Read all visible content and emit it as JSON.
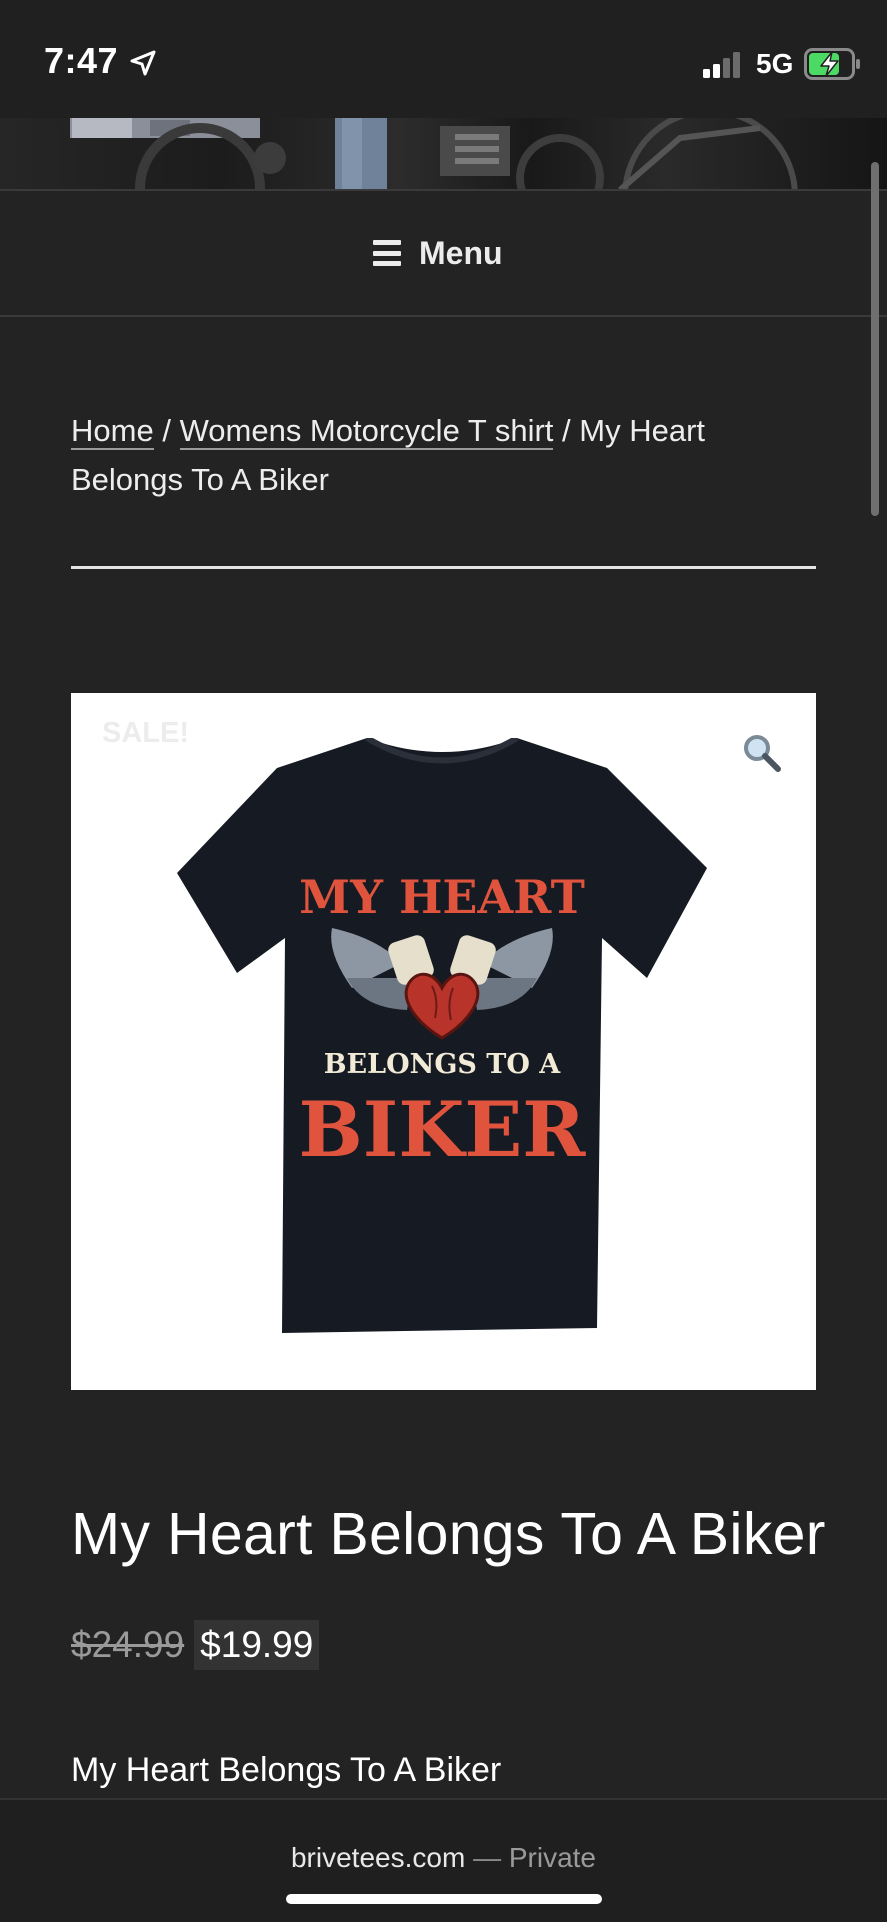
{
  "status_bar": {
    "time": "7:47",
    "network": "5G",
    "icons": [
      "location-arrow-icon",
      "signal-icon",
      "battery-charging-icon"
    ]
  },
  "nav": {
    "menu_label": "Menu",
    "menu_icon": "hamburger-icon"
  },
  "breadcrumb": {
    "items": [
      {
        "label": "Home",
        "link": true
      },
      {
        "label": "Womens Motorcycle T shirt",
        "link": true
      },
      {
        "label": "My Heart Belongs To A Biker",
        "link": false
      }
    ],
    "separator": "/"
  },
  "product": {
    "sale_badge": "SALE!",
    "zoom_icon": "magnifier-icon",
    "shirt_text": {
      "line1": "MY HEART",
      "line2": "BELONGS TO A",
      "line3": "BIKER"
    },
    "title": "My Heart Belongs To A Biker",
    "price_old": "$24.99",
    "price_new": "$19.99",
    "subtitle": "My Heart Belongs To A Biker"
  },
  "browser": {
    "domain": "brivetees.com",
    "separator": "—",
    "mode": "Private"
  },
  "colors": {
    "background": "#232323",
    "shirt": "#161a22",
    "shirt_text_red": "#e0543d",
    "shirt_text_cream": "#f1ead6",
    "price_highlight": "#333333"
  }
}
